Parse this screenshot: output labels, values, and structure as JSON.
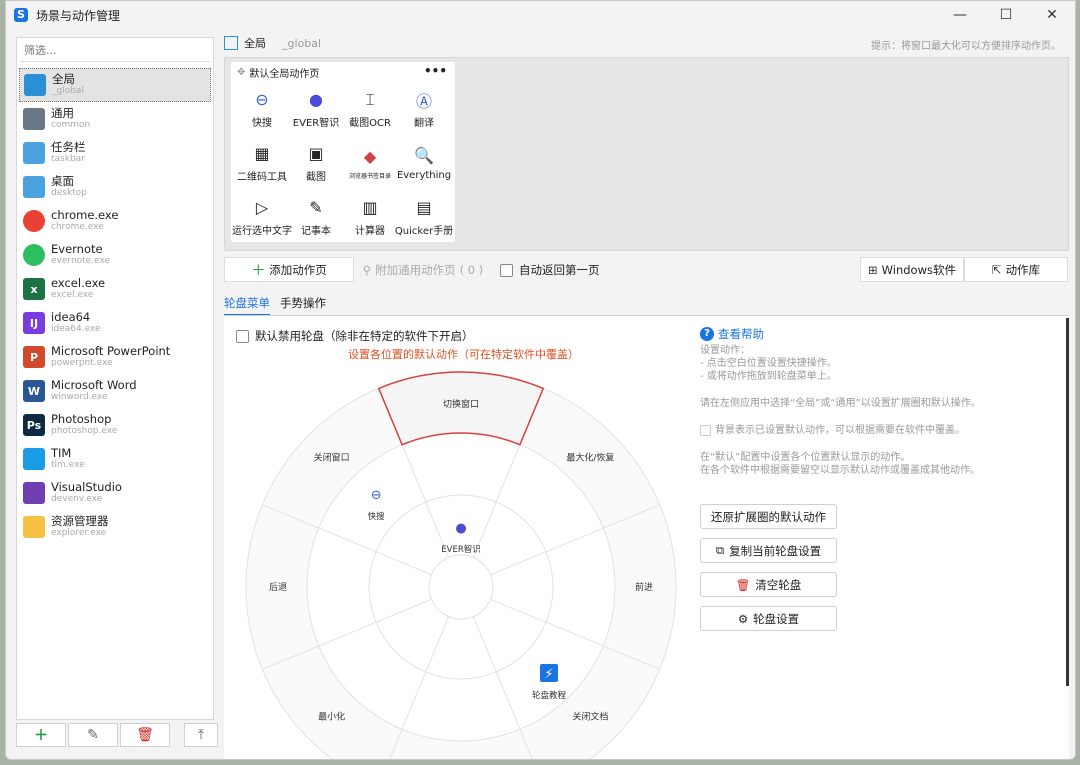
{
  "window": {
    "title": "场景与动作管理"
  },
  "sidebar": {
    "filter_placeholder": "筛选...",
    "apps": [
      {
        "name": "全局",
        "id": "_global",
        "icon": "grid-icon",
        "color": "#2a8fd6",
        "selected": true
      },
      {
        "name": "通用",
        "id": "common",
        "icon": "tiles-icon",
        "color": "#6c7785"
      },
      {
        "name": "任务栏",
        "id": "taskbar",
        "icon": "taskbar-icon",
        "color": "#4aa3e0"
      },
      {
        "name": "桌面",
        "id": "desktop",
        "icon": "desktop-icon",
        "color": "#4aa3e0"
      },
      {
        "name": "chrome.exe",
        "id": "chrome.exe",
        "icon": "chrome-icon",
        "color": "#e94235"
      },
      {
        "name": "Evernote",
        "id": "evernote.exe",
        "icon": "evernote-icon",
        "color": "#2dbe60"
      },
      {
        "name": "excel.exe",
        "id": "excel.exe",
        "icon": "excel-icon",
        "color": "#1e7145"
      },
      {
        "name": "idea64",
        "id": "idea64.exe",
        "icon": "idea-icon",
        "color": "#7a3ce0"
      },
      {
        "name": "Microsoft PowerPoint",
        "id": "powerpnt.exe",
        "icon": "powerpoint-icon",
        "color": "#d04a2b"
      },
      {
        "name": "Microsoft Word",
        "id": "winword.exe",
        "icon": "word-icon",
        "color": "#2b5797"
      },
      {
        "name": "Photoshop",
        "id": "photoshop.exe",
        "icon": "photoshop-icon",
        "color": "#0d2a40"
      },
      {
        "name": "TIM",
        "id": "tim.exe",
        "icon": "tim-icon",
        "color": "#1a9be6"
      },
      {
        "name": "VisualStudio",
        "id": "devenv.exe",
        "icon": "visualstudio-icon",
        "color": "#6f3eb0"
      },
      {
        "name": "资源管理器",
        "id": "explorer.exe",
        "icon": "folder-icon",
        "color": "#f4c142"
      }
    ],
    "letters": {
      "excel": "x",
      "word": "W",
      "ppt": "P",
      "ps": "Ps",
      "idea": "IJ"
    }
  },
  "breadcrumb": {
    "name": "全局",
    "id": "_global"
  },
  "hint": "提示：将窗口最大化可以方便排序动作页。",
  "action_page": {
    "title": "默认全局动作页",
    "menu": "•••",
    "actions": [
      {
        "label": "快搜",
        "icon": "search-icon",
        "glyph": "⊖"
      },
      {
        "label": "EVER智识",
        "icon": "ever-icon",
        "glyph": "●"
      },
      {
        "label": "截图OCR",
        "icon": "ocr-icon",
        "glyph": "⌶"
      },
      {
        "label": "翻译",
        "icon": "translate-icon",
        "glyph": "Ⓐ"
      },
      {
        "label": "二维码工具",
        "icon": "qrcode-icon",
        "glyph": "▦"
      },
      {
        "label": "截图",
        "icon": "screenshot-icon",
        "glyph": "▣"
      },
      {
        "label": "浏览器书签目录",
        "icon": "bookmark-icon",
        "glyph": "◆",
        "small": true
      },
      {
        "label": "Everything",
        "icon": "everything-icon",
        "glyph": "🔍"
      },
      {
        "label": "运行选中文字",
        "icon": "run-icon",
        "glyph": "▷"
      },
      {
        "label": "记事本",
        "icon": "notepad-icon",
        "glyph": "✎"
      },
      {
        "label": "计算器",
        "icon": "calculator-icon",
        "glyph": "▥"
      },
      {
        "label": "Quicker手册",
        "icon": "manual-icon",
        "glyph": "▤"
      }
    ]
  },
  "toolbar": {
    "add_page": "添加动作页",
    "attach_page": "附加通用动作页",
    "attach_count": "( 0 )",
    "auto_return": "自动返回第一页",
    "windows_apps": "Windows软件",
    "action_library": "动作库"
  },
  "tabs": [
    "轮盘菜单",
    "手势操作"
  ],
  "wheel": {
    "disable_label": "默认禁用轮盘（除非在特定的软件下开启）",
    "default_hint": "设置各位置的默认动作（可在特定软件中覆盖）",
    "outer_labels": [
      "切换窗口",
      "最大化/恢复",
      "前进",
      "关闭文档",
      "最小化",
      "后退",
      "关闭窗口"
    ],
    "inner_actions": [
      {
        "label": "快搜",
        "icon": "search-icon",
        "glyph": "⊖"
      },
      {
        "label": "EVER智识",
        "icon": "ever-icon",
        "glyph": "●"
      },
      {
        "label": "轮盘教程",
        "icon": "lightning-icon",
        "glyph": "⚡"
      }
    ]
  },
  "help": {
    "link": "查看帮助",
    "lines": [
      "设置动作：",
      "- 点击空白位置设置快捷操作。",
      "- 或将动作拖放到轮盘菜单上。"
    ],
    "para2": "请在左侧应用中选择“全局”或“通用”以设置扩展圈和默认操作。",
    "legend": "背景表示已设置默认动作，可以根据需要在软件中覆盖。",
    "para3_1": "在“默认”配置中设置各个位置默认显示的动作。",
    "para3_2": "在各个软件中根据需要留空以显示默认动作或覆盖成其他动作。"
  },
  "wheel_buttons": {
    "restore": "还原扩展圈的默认动作",
    "copy": "复制当前轮盘设置",
    "clear": "清空轮盘",
    "settings": "轮盘设置"
  },
  "colors": {
    "accent": "#1b74e4",
    "warn": "#e05020",
    "sector": "#d94040"
  }
}
